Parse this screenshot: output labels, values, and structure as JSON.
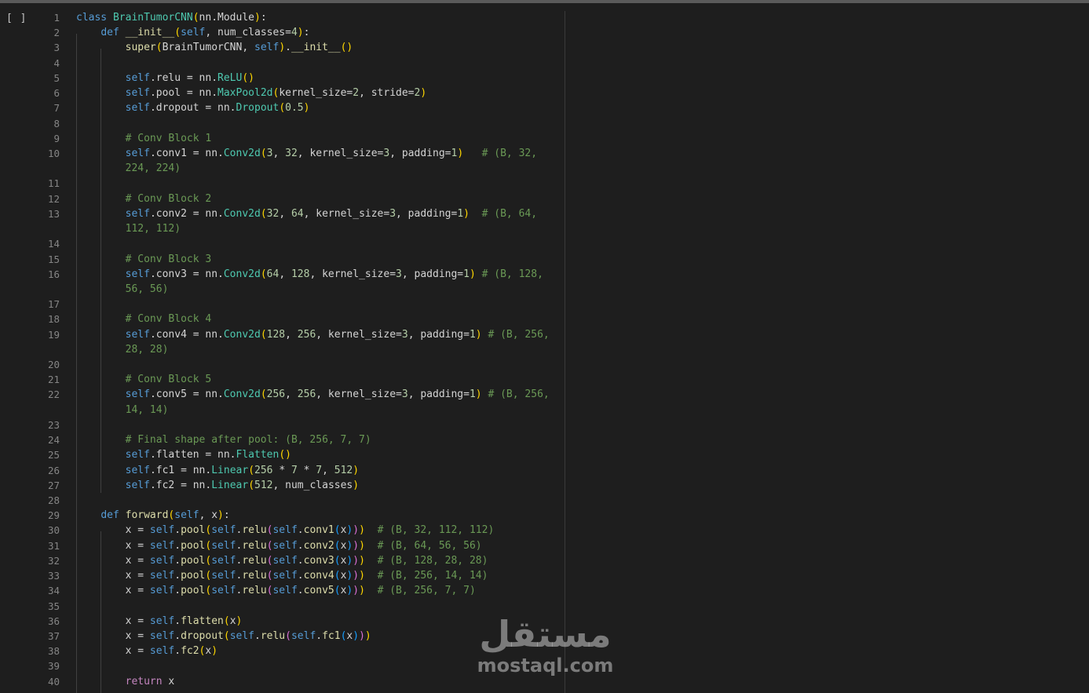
{
  "cell": {
    "run_indicator": "[ ]"
  },
  "lines": [
    {
      "n": "1",
      "t": "class BrainTumorCNN(nn.Module):"
    },
    {
      "n": "2",
      "t": "    def __init__(self, num_classes=4):"
    },
    {
      "n": "3",
      "t": "        super(BrainTumorCNN, self).__init__()"
    },
    {
      "n": "4",
      "t": ""
    },
    {
      "n": "5",
      "t": "        self.relu = nn.ReLU()"
    },
    {
      "n": "6",
      "t": "        self.pool = nn.MaxPool2d(kernel_size=2, stride=2)"
    },
    {
      "n": "7",
      "t": "        self.dropout = nn.Dropout(0.5)"
    },
    {
      "n": "8",
      "t": ""
    },
    {
      "n": "9",
      "t": "        # Conv Block 1"
    },
    {
      "n": "10",
      "t": "        self.conv1 = nn.Conv2d(3, 32, kernel_size=3, padding=1)   # (B, 32,"
    },
    {
      "n": "",
      "t": "        224, 224)"
    },
    {
      "n": "11",
      "t": ""
    },
    {
      "n": "12",
      "t": "        # Conv Block 2"
    },
    {
      "n": "13",
      "t": "        self.conv2 = nn.Conv2d(32, 64, kernel_size=3, padding=1)  # (B, 64,"
    },
    {
      "n": "",
      "t": "        112, 112)"
    },
    {
      "n": "14",
      "t": ""
    },
    {
      "n": "15",
      "t": "        # Conv Block 3"
    },
    {
      "n": "16",
      "t": "        self.conv3 = nn.Conv2d(64, 128, kernel_size=3, padding=1) # (B, 128,"
    },
    {
      "n": "",
      "t": "        56, 56)"
    },
    {
      "n": "17",
      "t": ""
    },
    {
      "n": "18",
      "t": "        # Conv Block 4"
    },
    {
      "n": "19",
      "t": "        self.conv4 = nn.Conv2d(128, 256, kernel_size=3, padding=1) # (B, 256,"
    },
    {
      "n": "",
      "t": "        28, 28)"
    },
    {
      "n": "20",
      "t": ""
    },
    {
      "n": "21",
      "t": "        # Conv Block 5"
    },
    {
      "n": "22",
      "t": "        self.conv5 = nn.Conv2d(256, 256, kernel_size=3, padding=1) # (B, 256,"
    },
    {
      "n": "",
      "t": "        14, 14)"
    },
    {
      "n": "23",
      "t": ""
    },
    {
      "n": "24",
      "t": "        # Final shape after pool: (B, 256, 7, 7)"
    },
    {
      "n": "25",
      "t": "        self.flatten = nn.Flatten()"
    },
    {
      "n": "26",
      "t": "        self.fc1 = nn.Linear(256 * 7 * 7, 512)"
    },
    {
      "n": "27",
      "t": "        self.fc2 = nn.Linear(512, num_classes)"
    },
    {
      "n": "28",
      "t": ""
    },
    {
      "n": "29",
      "t": "    def forward(self, x):"
    },
    {
      "n": "30",
      "t": "        x = self.pool(self.relu(self.conv1(x)))  # (B, 32, 112, 112)"
    },
    {
      "n": "31",
      "t": "        x = self.pool(self.relu(self.conv2(x)))  # (B, 64, 56, 56)"
    },
    {
      "n": "32",
      "t": "        x = self.pool(self.relu(self.conv3(x)))  # (B, 128, 28, 28)"
    },
    {
      "n": "33",
      "t": "        x = self.pool(self.relu(self.conv4(x)))  # (B, 256, 14, 14)"
    },
    {
      "n": "34",
      "t": "        x = self.pool(self.relu(self.conv5(x)))  # (B, 256, 7, 7)"
    },
    {
      "n": "35",
      "t": ""
    },
    {
      "n": "36",
      "t": "        x = self.flatten(x)"
    },
    {
      "n": "37",
      "t": "        x = self.dropout(self.relu(self.fc1(x)))"
    },
    {
      "n": "38",
      "t": "        x = self.fc2(x)"
    },
    {
      "n": "39",
      "t": ""
    },
    {
      "n": "40",
      "t": "        return x"
    }
  ],
  "watermark": {
    "arabic": "مستقل",
    "latin": "mostaql.com"
  },
  "colors": {
    "background": "#1e1e1e",
    "keyword": "#569cd6",
    "class_name": "#4ec9b0",
    "function": "#dcdcaa",
    "number": "#b5cea8",
    "comment": "#6a9955",
    "line_number": "#858585"
  }
}
